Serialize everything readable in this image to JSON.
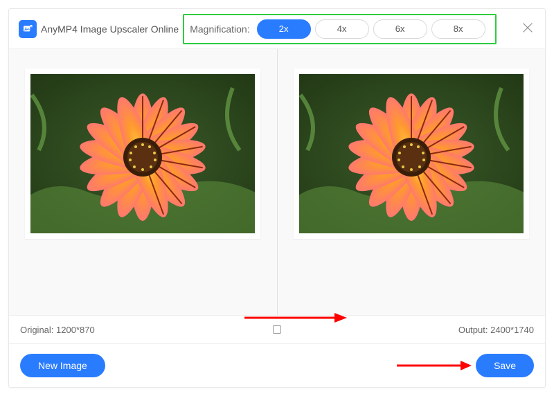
{
  "header": {
    "title": "AnyMP4 Image Upscaler Online",
    "magnification_label": "Magnification:",
    "options": [
      "2x",
      "4x",
      "6x",
      "8x"
    ],
    "active_option": "2x"
  },
  "preview": {
    "original_label": "Original: 1200*870",
    "output_label": "Output: 2400*1740"
  },
  "footer": {
    "new_image_label": "New Image",
    "save_label": "Save"
  },
  "colors": {
    "accent": "#2a7cff",
    "highlight_border": "#2ecc40",
    "arrow": "#ff0000"
  }
}
